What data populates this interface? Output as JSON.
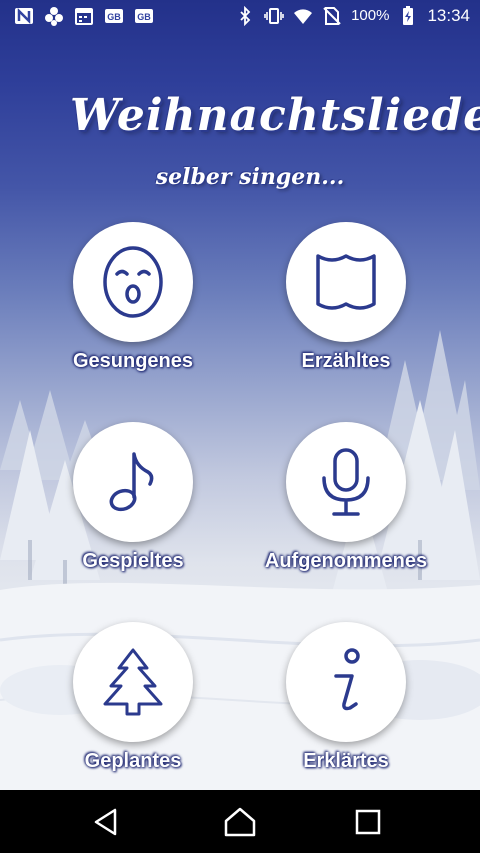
{
  "status_bar": {
    "battery_percent": "100%",
    "time": "13:34",
    "left_icons": [
      "n-app-icon",
      "cluster-app-icon",
      "calendar-icon",
      "gb-news-icon",
      "gb-news-icon"
    ],
    "right_icons": [
      "bluetooth-icon",
      "vibrate-icon",
      "wifi-icon",
      "no-sim-icon",
      "battery-charging-icon"
    ]
  },
  "title": {
    "main": "Weihnachtslieder",
    "sub": "selber singen..."
  },
  "menu": {
    "items": [
      {
        "label": "Gesungenes",
        "icon": "singing-face-icon"
      },
      {
        "label": "Erzähltes",
        "icon": "open-book-icon"
      },
      {
        "label": "Gespieltes",
        "icon": "music-note-icon"
      },
      {
        "label": "Aufgenommenes",
        "icon": "microphone-icon"
      },
      {
        "label": "Geplantes",
        "icon": "christmas-tree-icon"
      },
      {
        "label": "Erklärtes",
        "icon": "info-icon"
      }
    ]
  },
  "colors": {
    "accent": "#2b3a8e",
    "sky_top": "#23318a",
    "nav_bar": "#000000"
  },
  "nav_bar": {
    "buttons": [
      "back-icon",
      "home-icon",
      "recents-icon"
    ]
  }
}
